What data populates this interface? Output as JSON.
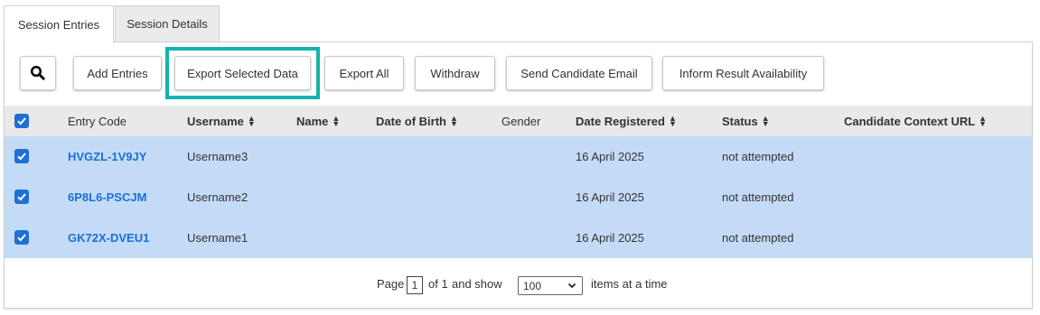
{
  "tabs": [
    {
      "label": "Session Entries",
      "active": true
    },
    {
      "label": "Session Details",
      "active": false
    }
  ],
  "toolbar": {
    "search_icon": "search-icon",
    "buttons": {
      "add_entries": "Add Entries",
      "export_selected": "Export Selected Data",
      "export_all": "Export All",
      "withdraw": "Withdraw",
      "send_email": "Send Candidate Email",
      "inform_result": "Inform Result Availability"
    },
    "highlight_color": "#14b3ad"
  },
  "table": {
    "headers": {
      "entry_code": "Entry Code",
      "username": "Username",
      "name": "Name",
      "dob": "Date of Birth",
      "gender": "Gender",
      "date_registered": "Date Registered",
      "status": "Status",
      "context_url": "Candidate Context URL"
    },
    "rows": [
      {
        "entry_code": "HVGZL-1V9JY",
        "username": "Username3",
        "name": "",
        "dob": "",
        "gender": "",
        "date_registered": "16 April 2025",
        "status": "not attempted",
        "context_url": "",
        "checked": true
      },
      {
        "entry_code": "6P8L6-PSCJM",
        "username": "Username2",
        "name": "",
        "dob": "",
        "gender": "",
        "date_registered": "16 April 2025",
        "status": "not attempted",
        "context_url": "",
        "checked": true
      },
      {
        "entry_code": "GK72X-DVEU1",
        "username": "Username1",
        "name": "",
        "dob": "",
        "gender": "",
        "date_registered": "16 April 2025",
        "status": "not attempted",
        "context_url": "",
        "checked": true
      }
    ],
    "row_highlight_color": "#c4dbf7",
    "link_color": "#1a6fd6",
    "checkbox_color": "#1f6fd4"
  },
  "pagination": {
    "page_label": "Page",
    "current_page": "1",
    "of_label": "of 1",
    "and_show": "and show",
    "page_size": "100",
    "items_label": "items at a time"
  }
}
